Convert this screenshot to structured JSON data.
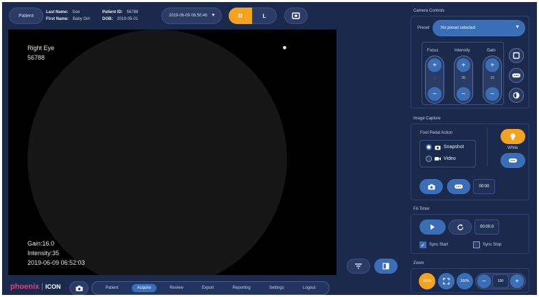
{
  "header": {
    "patient_button": "Patient",
    "last_name_label": "Last Name:",
    "last_name": "Doe",
    "first_name_label": "First Name:",
    "first_name": "Baby Girl",
    "patient_id_label": "Patient ID:",
    "patient_id": "56788",
    "dob_label": "DOB:",
    "dob": "2019-05-01",
    "session": "2019-06-09 06:50:46",
    "eye_right": "R",
    "eye_left": "L"
  },
  "viewport": {
    "eye": "Right Eye",
    "id": "56788",
    "gain": "Gain:16.0",
    "intensity": "Intensity:35",
    "timestamp": "2019-06-09 06:52:03"
  },
  "camera": {
    "title": "Camera Controls",
    "preset_label": "Preset",
    "preset_value": "No preset selected",
    "focus_label": "Focus",
    "focus_value": "-",
    "intensity_label": "Intensity",
    "intensity_value": "35",
    "gain_label": "Gain",
    "gain_value": "16"
  },
  "capture": {
    "title": "Image Capture",
    "foot_pedal_label": "Foot Pedal Action",
    "snapshot_label": "Snapshot",
    "video_label": "Video",
    "white_label": "White",
    "timer": "00:00"
  },
  "fa_timer": {
    "title": "FA Timer",
    "value": "00:00.0",
    "sync_start": "Sync Start",
    "sync_stop": "Sync Stop"
  },
  "zoom": {
    "title": "Zoom",
    "z100": "100%",
    "z200": "200%",
    "value": "100"
  },
  "nav": {
    "brand_a": "phoenix",
    "brand_b": "ICON",
    "items": [
      "Patient",
      "Acquire",
      "Review",
      "Export",
      "Reporting",
      "Settings",
      "Logout"
    ],
    "active": "Acquire"
  },
  "colors": {
    "background": "#1b2a4c",
    "accent": "#f3a320",
    "active_blue": "#3a6fb8",
    "brand_pink": "#e0407a"
  }
}
